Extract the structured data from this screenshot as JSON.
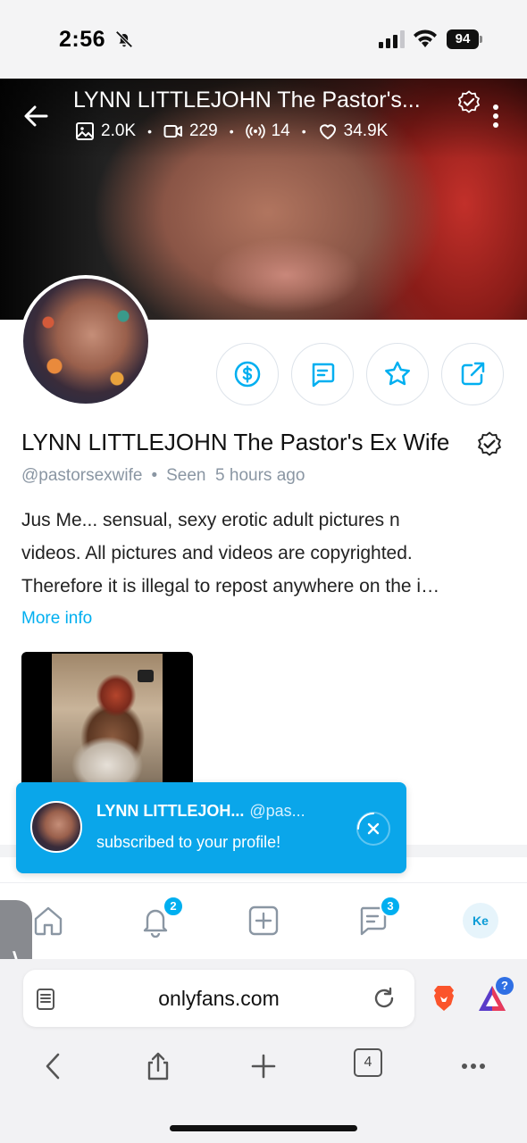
{
  "status_bar": {
    "time": "2:56",
    "battery": "94"
  },
  "cover": {
    "title": "LYNN LITTLEJOHN The Pastor's...",
    "stats": {
      "photos": "2.0K",
      "videos": "229",
      "streams": "14",
      "likes": "34.9K"
    }
  },
  "profile": {
    "name": "LYNN LITTLEJOHN The Pastor's Ex Wife",
    "handle": "@pastorsexwife",
    "seen_label": "Seen",
    "seen_time": "5 hours ago",
    "bio_lines": [
      "Jus Me... sensual, sexy erotic adult pictures n",
      "videos. All pictures and videos are copyrighted.",
      "Therefore it is illegal to repost anywhere on the i…"
    ],
    "more_info": "More info"
  },
  "toast": {
    "name": "LYNN LITTLEJOH...",
    "handle": "@pas...",
    "message": "subscribed to your profile!"
  },
  "app_nav": {
    "notifications_badge": "2",
    "messages_badge": "3",
    "user_initials": "Ke"
  },
  "browser": {
    "url": "onlyfans.com",
    "tab_count": "4",
    "rewards_badge": "?"
  },
  "colors": {
    "accent": "#00aff0",
    "toast": "#0aa6ea"
  },
  "icons": [
    "bell-off-icon",
    "signal-icon",
    "wifi-icon",
    "back-arrow-icon",
    "verified-icon",
    "more-vertical-icon",
    "image-icon",
    "video-icon",
    "broadcast-icon",
    "heart-icon",
    "dollar-icon",
    "message-icon",
    "star-icon",
    "share-icon",
    "close-icon",
    "home-icon",
    "bell-icon",
    "plus-square-icon",
    "chat-icon",
    "reader-icon",
    "reload-icon",
    "brave-lion-icon",
    "rewards-triangle-icon",
    "chevron-left-icon",
    "share-up-icon",
    "plus-icon",
    "more-horizontal-icon"
  ]
}
